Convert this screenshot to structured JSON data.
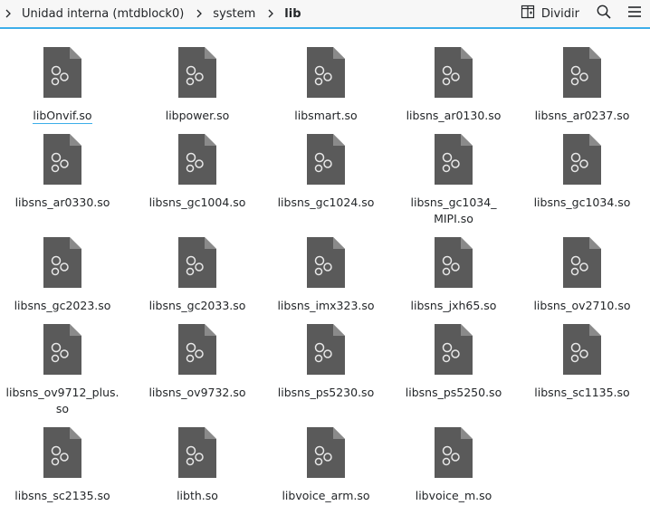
{
  "breadcrumb": {
    "items": [
      {
        "label": "Unidad interna (mtdblock0)"
      },
      {
        "label": "system"
      },
      {
        "label": "lib"
      }
    ]
  },
  "toolbar": {
    "split_label": "Dividir",
    "split_icon": "split-view-icon",
    "search_icon": "search-icon",
    "menu_icon": "hamburger-menu-icon"
  },
  "colors": {
    "accent": "#3daee9",
    "file_icon": "#5a5a5a"
  },
  "files": [
    {
      "name": "libOnvif.so",
      "focused": true
    },
    {
      "name": "libpower.so"
    },
    {
      "name": "libsmart.so"
    },
    {
      "name": "libsns_ar0130.so"
    },
    {
      "name": "libsns_ar0237.so"
    },
    {
      "name": "libsns_ar0330.so"
    },
    {
      "name": "libsns_gc1004.so"
    },
    {
      "name": "libsns_gc1024.so"
    },
    {
      "name": "libsns_gc1034_\nMIPI.so"
    },
    {
      "name": "libsns_gc1034.so"
    },
    {
      "name": "libsns_gc2023.so"
    },
    {
      "name": "libsns_gc2033.so"
    },
    {
      "name": "libsns_imx323.so"
    },
    {
      "name": "libsns_jxh65.so"
    },
    {
      "name": "libsns_ov2710.so"
    },
    {
      "name": "libsns_ov9712_plus.\nso"
    },
    {
      "name": "libsns_ov9732.so"
    },
    {
      "name": "libsns_ps5230.so"
    },
    {
      "name": "libsns_ps5250.so"
    },
    {
      "name": "libsns_sc1135.so"
    },
    {
      "name": "libsns_sc2135.so"
    },
    {
      "name": "libth.so"
    },
    {
      "name": "libvoice_arm.so"
    },
    {
      "name": "libvoice_m.so"
    }
  ]
}
